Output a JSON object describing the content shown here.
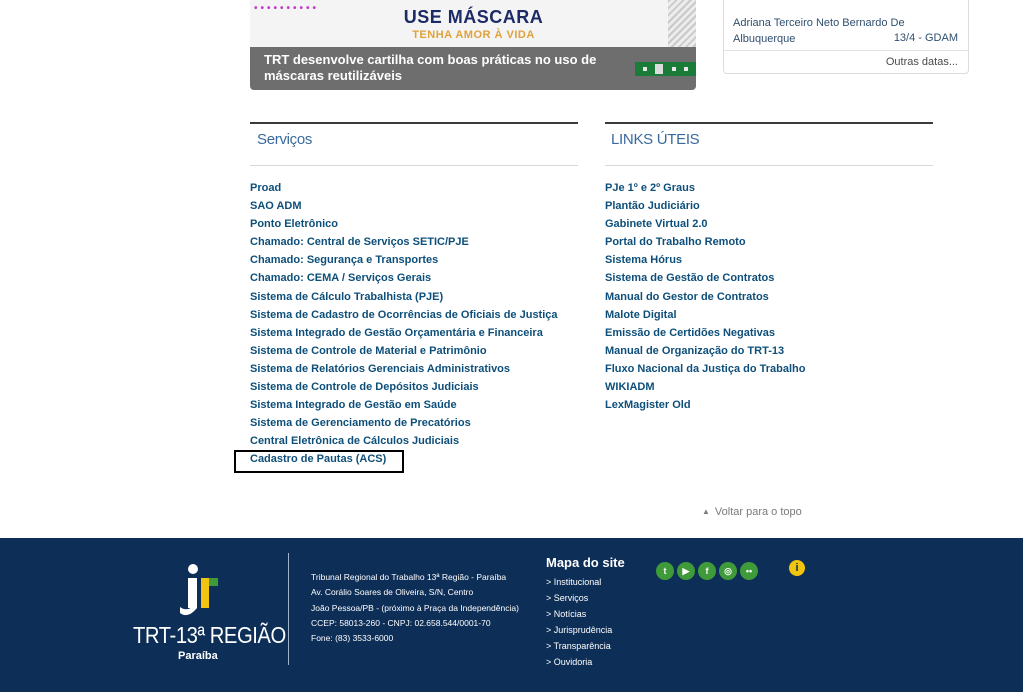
{
  "news": {
    "art_title": "USE MÁSCARA",
    "art_subtitle": "TENHA AMOR À VIDA",
    "caption": "TRT desenvolve cartilha com boas práticas no uso de máscaras reutilizáveis"
  },
  "birthdays": {
    "name": "Adriana Terceiro Neto Bernardo De Albuquerque",
    "date": "13/4 - GDAM",
    "more_link": "Outras datas..."
  },
  "services": {
    "title": "Serviços",
    "items": [
      "Proad",
      "SAO ADM",
      "Ponto Eletrônico",
      "Chamado: Central de Serviços SETIC/PJE",
      "Chamado: Segurança e Transportes",
      "Chamado: CEMA / Serviços Gerais",
      "Sistema de Cálculo Trabalhista (PJE)",
      "Sistema de Cadastro de Ocorrências de Oficiais de Justiça",
      "Sistema Integrado de Gestão Orçamentária e Financeira",
      "Sistema de Controle de Material e Patrimônio",
      "Sistema de Relatórios Gerenciais Administrativos",
      "Sistema de Controle de Depósitos Judiciais",
      "Sistema Integrado de Gestão em Saúde",
      "Sistema de Gerenciamento de Precatórios",
      "Central Eletrônica de Cálculos Judiciais",
      "Cadastro de Pautas (ACS)"
    ]
  },
  "useful_links": {
    "title": "LINKS ÚTEIS",
    "items": [
      "PJe 1º e 2º Graus",
      "Plantão Judiciário",
      "Gabinete Virtual 2.0",
      "Portal do Trabalho Remoto",
      "Sistema Hórus",
      "Sistema de Gestão de Contratos",
      "Manual do Gestor de Contratos",
      "Malote Digital",
      "Emissão de Certidões Negativas",
      "Manual de Organização do TRT-13",
      "Fluxo Nacional da Justiça do Trabalho",
      "WIKIADM",
      "LexMagister Old"
    ]
  },
  "back_to_top": "Voltar para o topo",
  "footer": {
    "logo_name": "TRT-13ª REGIÃO",
    "logo_region": "Paraíba",
    "address_lines": [
      "Tribunal Regional do Trabalho 13ª Região - Paraíba",
      "Av. Corálio Soares de Oliveira, S/N, Centro",
      "João Pessoa/PB - (próximo à Praça da Independência)",
      "CCEP: 58013-260 - CNPJ: 02.658.544/0001-70",
      "Fone: (83) 3533-6000"
    ],
    "sitemap_title": "Mapa do site",
    "sitemap_items": [
      "> Institucional",
      "> Serviços",
      "> Notícias",
      "> Jurisprudência",
      "> Transparência",
      "> Ouvidoria"
    ],
    "social_icons": [
      "twitter-icon",
      "youtube-icon",
      "facebook-icon",
      "instagram-icon",
      "flickr-icon"
    ],
    "colors": {
      "background": "#0d2e57",
      "social": "#3f9a3a",
      "info": "#f1c40f"
    }
  }
}
